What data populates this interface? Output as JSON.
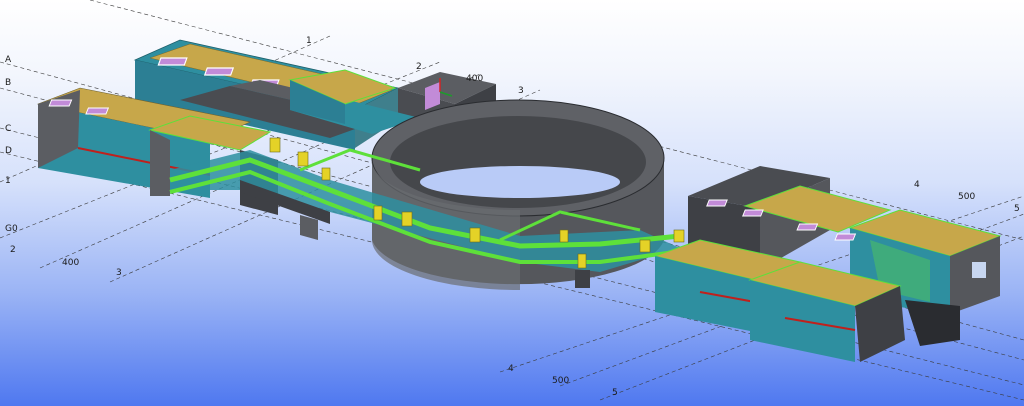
{
  "view": {
    "grid_labels_left": [
      "A",
      "B",
      "C",
      "D",
      "1",
      "G0",
      "2",
      "400",
      "3"
    ],
    "grid_labels_top": [
      "1",
      "2",
      "400",
      "3"
    ],
    "grid_labels_right": [
      "4",
      "500",
      "5"
    ],
    "grid_labels_bottom": [
      "4",
      "500",
      "5"
    ]
  },
  "colors": {
    "background_top": "#ffffff",
    "background_bottom": "#4f78f0",
    "concrete": "#5b5d62",
    "concrete_dark": "#3e4045",
    "wall_teal": "#2e8fa0",
    "steel_green": "#5ee03a",
    "slab_yellow": "#c7a74a",
    "opening_purple": "#c28bd8",
    "edge_red": "#c0201c",
    "grid_line": "#3a3a3a"
  }
}
